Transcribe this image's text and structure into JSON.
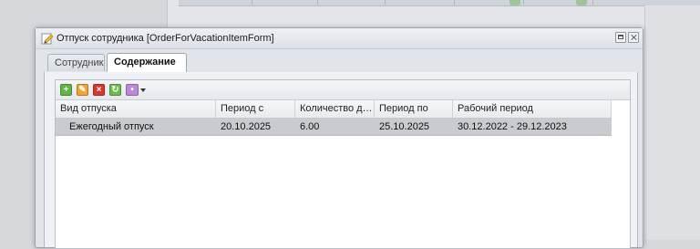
{
  "window": {
    "title": "Отпуск сотрудника [OrderForVacationItemForm]",
    "icon": "edit-document-icon"
  },
  "tabs": [
    {
      "label": "Сотрудник",
      "active": false
    },
    {
      "label": "Содержание",
      "active": true
    }
  ],
  "toolbar": {
    "buttons": [
      {
        "name": "add-icon",
        "glyph": "+",
        "color": "#62b447"
      },
      {
        "name": "edit-icon",
        "glyph": "✎",
        "color": "#f0a332"
      },
      {
        "name": "delete-icon",
        "glyph": "×",
        "color": "#d7372d"
      },
      {
        "name": "refresh-icon",
        "glyph": "↻",
        "color": "#6dbb4c"
      },
      {
        "name": "more-actions-icon",
        "glyph": "•",
        "color": "#b98ad6"
      }
    ]
  },
  "grid": {
    "columns": [
      "Вид отпуска",
      "Период с",
      "Количество дне...",
      "Период по",
      "Рабочий период"
    ],
    "rows": [
      [
        "Ежегодный отпуск",
        "20.10.2025",
        "6.00",
        "25.10.2025",
        "30.12.2022 - 29.12.2023"
      ]
    ],
    "selected_row": 0
  },
  "colors": {
    "selected_row": "#c9cbcf",
    "window_bg": "#e1e4e9"
  }
}
